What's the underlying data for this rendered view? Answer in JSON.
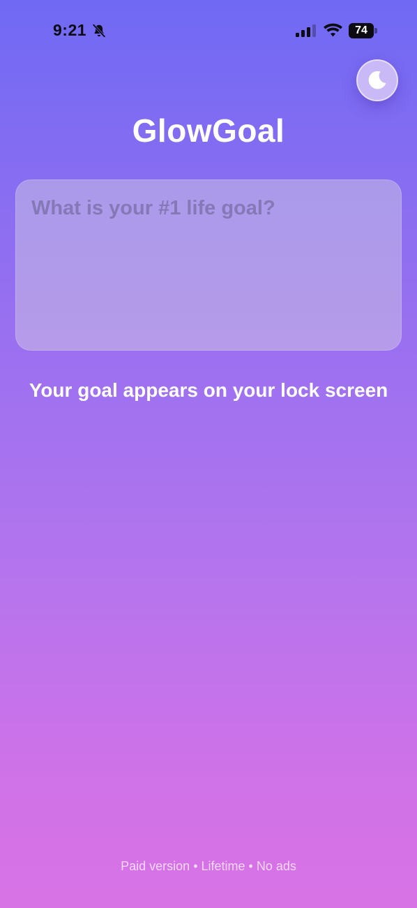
{
  "status_bar": {
    "time": "9:21",
    "battery": "74",
    "battery_level": 0.74,
    "icons": [
      "bell-slash-icon",
      "signal-icon",
      "wifi-icon",
      "battery-icon"
    ]
  },
  "theme_toggle": {
    "icon": "moon-icon"
  },
  "app": {
    "title": "GlowGoal"
  },
  "goal_input": {
    "value": "",
    "placeholder": "What is your #1 life goal?"
  },
  "subtitle": "Your goal appears on your lock screen",
  "footer": "Paid version • Lifetime • No ads",
  "colors": {
    "gradient_top": "#7069f4",
    "gradient_bottom": "#d873e5",
    "text": "#ffffff",
    "status_text": "#0c0c12"
  }
}
